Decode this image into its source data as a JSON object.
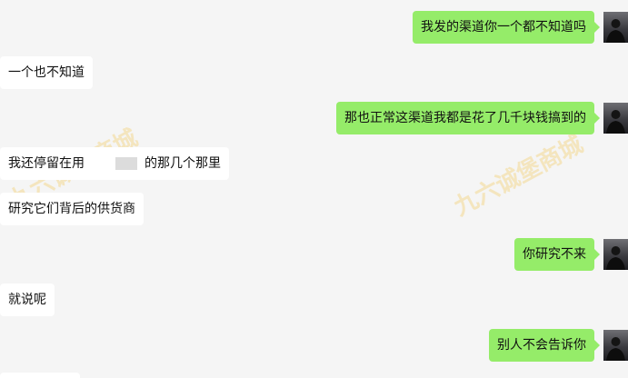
{
  "watermark_text": "九六诚堡商城",
  "messages": [
    {
      "side": "out",
      "text": "我发的渠道你一个都不知道吗"
    },
    {
      "side": "in",
      "text": "一个也不知道"
    },
    {
      "side": "out",
      "text": "那也正常这渠道我都是花了几千块钱搞到的"
    },
    {
      "side": "in",
      "text_before": "我还停留在用",
      "text_after": "的那几个那里"
    },
    {
      "side": "in",
      "text": "研究它们背后的供货商"
    },
    {
      "side": "out",
      "text": "你研究不来"
    },
    {
      "side": "in",
      "text": "就说呢"
    },
    {
      "side": "out",
      "text": "别人不会告诉你"
    }
  ],
  "colors": {
    "background": "#f5f5f5",
    "bubble_in": "#ffffff",
    "bubble_out": "#95ec69",
    "watermark": "#f4c85a"
  },
  "icons": {
    "avatar": "user-avatar"
  }
}
